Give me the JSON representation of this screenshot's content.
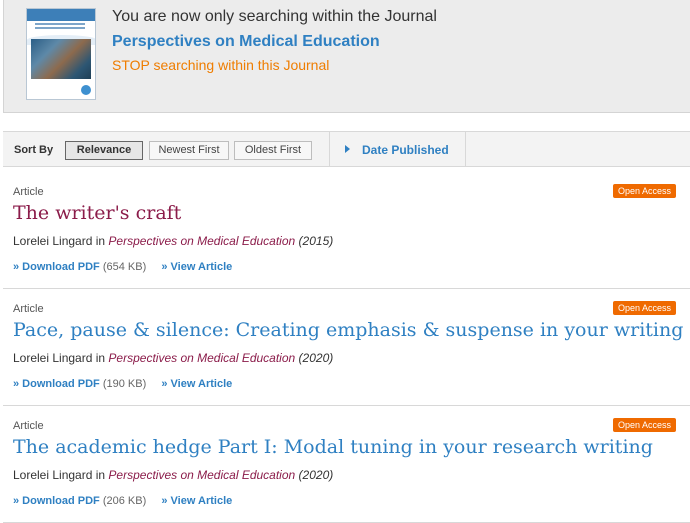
{
  "banner": {
    "searching_text": "You are now only searching within the Journal",
    "journal_name": "Perspectives on Medical Education",
    "stop_text": "STOP searching within this Journal",
    "cover_icon": "journal-cover-thumbnail"
  },
  "sort": {
    "label": "Sort By",
    "options": [
      "Relevance",
      "Newest First",
      "Oldest First"
    ],
    "selected": "Relevance",
    "filter_label": "Date Published"
  },
  "results": [
    {
      "type": "Article",
      "badge": "Open Access",
      "title": "The writer's craft",
      "author": "Lorelei Lingard",
      "in": "in",
      "journal": "Perspectives on Medical Education",
      "year": "(2015)",
      "download_label": "» Download PDF",
      "size": "(654 KB)",
      "view_label": "» View Article",
      "title_color": "#8b1c4a"
    },
    {
      "type": "Article",
      "badge": "Open Access",
      "title": "Pace, pause & silence: Creating emphasis & suspense in your writing",
      "author": "Lorelei Lingard",
      "in": "in",
      "journal": "Perspectives on Medical Education",
      "year": "(2020)",
      "download_label": "» Download PDF",
      "size": "(190 KB)",
      "view_label": "» View Article",
      "title_color": "#2f80c2"
    },
    {
      "type": "Article",
      "badge": "Open Access",
      "title": "The academic hedge Part I: Modal tuning in your research writing",
      "author": "Lorelei Lingard",
      "in": "in",
      "journal": "Perspectives on Medical Education",
      "year": "(2020)",
      "download_label": "» Download PDF",
      "size": "(206 KB)",
      "view_label": "» View Article",
      "title_color": "#2f80c2"
    }
  ],
  "colors": {
    "link_blue": "#2f80c2",
    "journal_magenta": "#8b1c4a",
    "badge_orange": "#ef6a00",
    "stop_orange": "#ef7d00"
  }
}
